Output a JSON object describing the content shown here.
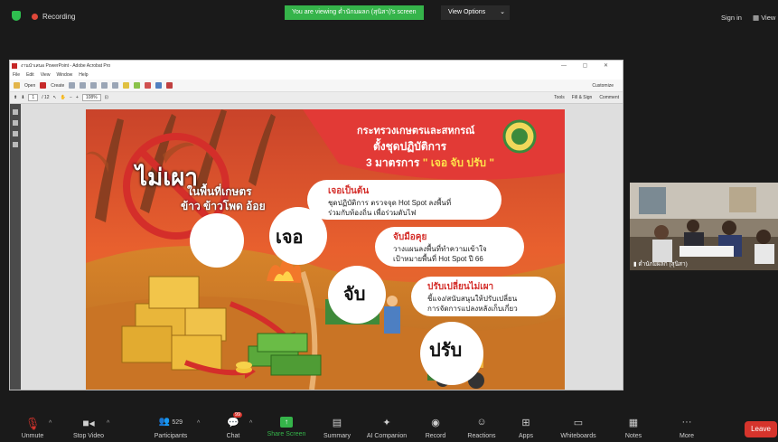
{
  "topbar": {
    "recording_label": "Recording",
    "viewing_banner": "You are viewing ต่ำนักมผลก (สุนิสา)'s screen",
    "view_options_label": "View Options",
    "sign_in_label": "Sign in",
    "view_label": "View"
  },
  "acrobat": {
    "title": "งานนำเสนอ PowerPoint - Adobe Acrobat Pro",
    "menu": [
      "File",
      "Edit",
      "View",
      "Window",
      "Help"
    ],
    "toolbar_open": "Open",
    "toolbar_create": "Create",
    "customize": "Customize",
    "page_current": "1",
    "page_total": "/ 12",
    "zoom": "108%",
    "right_tabs": [
      "Tools",
      "Fill & Sign",
      "Comment"
    ]
  },
  "slide": {
    "ministry": "กระทรวงเกษตรและสหกรณ์",
    "taskforce": "ตั้งชุดปฏิบัติการ",
    "measures_prefix": "3 มาตรการ",
    "measures_quote": "\" เจอ จับ ปรับ \"",
    "no_burn": "ไม่เผา",
    "no_burn_sub1": "ในพื้นที่เกษตร",
    "no_burn_sub2": "ข้าว ข้าวโพด อ้อย",
    "box1_title": "เจอเป็นต้น",
    "box1_line1": "ชุดปฏิบัติการ ตรวจจุด Hot Spot ลงพื้นที่",
    "box1_line2": "ร่วมกับท้องถิ่น เพื่อร่วมดับไฟ",
    "box2_title": "จับมือคุย",
    "box2_line1": "วางแผนลงพื้นที่ทำความเข้าใจ",
    "box2_line2": "เป้าหมายพื้นที่ Hot Spot ปี 66",
    "box3_title": "ปรับเปลี่ยนไม่เผา",
    "box3_line1": "ชี้แจง/สนับสนุนให้ปรับเปลี่ยน",
    "box3_line2": "การจัดการแปลงหลังเก็บเกี่ยว",
    "word1": "เจอ",
    "word2": "จับ",
    "word3": "ปรับ"
  },
  "camera": {
    "name": "ต่ำนักมผลก (สุนิสา)"
  },
  "bottombar": {
    "unmute": "Unmute",
    "stop_video": "Stop Video",
    "participants": "Participants",
    "participants_count": "529",
    "chat": "Chat",
    "chat_badge": "99",
    "share_screen": "Share Screen",
    "summary": "Summary",
    "ai_companion": "AI Companion",
    "record": "Record",
    "reactions": "Reactions",
    "apps": "Apps",
    "whiteboards": "Whiteboards",
    "notes": "Notes",
    "more": "More",
    "leave": "Leave"
  },
  "colors": {
    "zoom_green": "#35b44a",
    "leave_red": "#d6342c",
    "slide_red": "#e64630"
  }
}
